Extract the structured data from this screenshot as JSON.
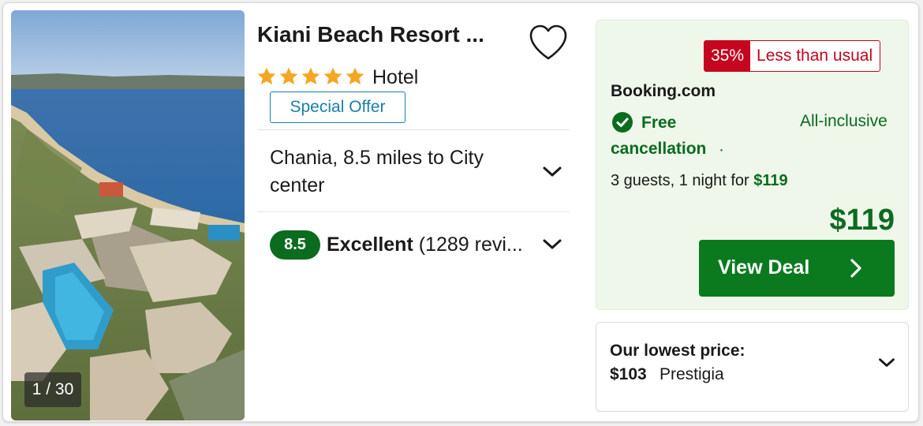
{
  "photo": {
    "counter": "1 / 30"
  },
  "hotel": {
    "name": "Kiani Beach Resort ...",
    "stars": 5,
    "type": "Hotel",
    "special_offer": "Special Offer",
    "location": "Chania, 8.5 miles to City center",
    "rating_score": "8.5",
    "rating_word": "Excellent",
    "rating_reviews": "(1289 revi..."
  },
  "deal": {
    "discount_percent": "35%",
    "discount_label": "Less than usual",
    "provider": "Booking.com",
    "free_cancellation": "Free cancellation",
    "separator": "·",
    "board": "All-inclusive",
    "guests_text": "3 guests, 1 night for",
    "guests_price": "$119",
    "price": "$119",
    "button_label": "View Deal"
  },
  "lowest": {
    "label": "Our lowest price:",
    "price": "$103",
    "provider": "Prestigia"
  },
  "colors": {
    "green_dark": "#0b6b1f",
    "green_button": "#0b7a1f",
    "deal_bg": "#eef7ea",
    "red": "#c4061e",
    "blue_offer": "#1a7ea9",
    "star": "#f5a623"
  },
  "icons": {
    "favorite": "heart-outline-icon",
    "star": "star-icon",
    "expand": "chevron-down-icon",
    "check": "check-circle-icon",
    "go": "chevron-right-icon"
  }
}
